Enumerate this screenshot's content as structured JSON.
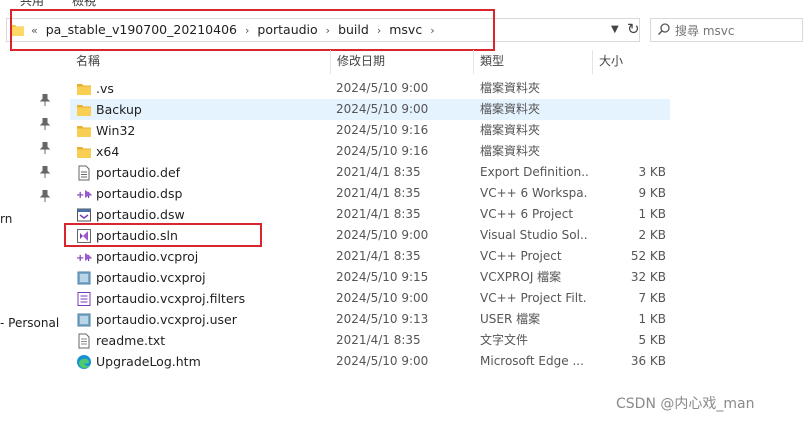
{
  "address_bar": {
    "overflow": "«",
    "crumbs": [
      "pa_stable_v190700_20210406",
      "portaudio",
      "build",
      "msvc"
    ]
  },
  "search": {
    "placeholder": "搜尋 msvc"
  },
  "nav": {
    "items": [
      {
        "label": "rn"
      },
      {
        "label": "- Personal"
      }
    ]
  },
  "columns": {
    "name": "名稱",
    "date": "修改日期",
    "type": "類型",
    "size": "大小"
  },
  "files": [
    {
      "icon": "folder-icon",
      "name": ".vs",
      "date": "2024/5/10 9:00",
      "type": "檔案資料夾",
      "size": ""
    },
    {
      "icon": "folder-icon",
      "name": "Backup",
      "date": "2024/5/10 9:00",
      "type": "檔案資料夾",
      "size": ""
    },
    {
      "icon": "folder-icon",
      "name": "Win32",
      "date": "2024/5/10 9:16",
      "type": "檔案資料夾",
      "size": ""
    },
    {
      "icon": "folder-icon",
      "name": "x64",
      "date": "2024/5/10 9:16",
      "type": "檔案資料夾",
      "size": ""
    },
    {
      "icon": "def-file-icon",
      "name": "portaudio.def",
      "date": "2021/4/1 8:35",
      "type": "Export Definition...",
      "size": "3 KB"
    },
    {
      "icon": "vcpp-project-icon",
      "name": "portaudio.dsp",
      "date": "2021/4/1 8:35",
      "type": "VC++ 6 Workspa...",
      "size": "9 KB"
    },
    {
      "icon": "dsw-file-icon",
      "name": "portaudio.dsw",
      "date": "2021/4/1 8:35",
      "type": "VC++ 6 Project",
      "size": "1 KB"
    },
    {
      "icon": "visual-studio-solution-icon",
      "name": "portaudio.sln",
      "date": "2024/5/10 9:00",
      "type": "Visual Studio Sol...",
      "size": "2 KB"
    },
    {
      "icon": "vcpp-project-icon",
      "name": "portaudio.vcproj",
      "date": "2021/4/1 8:35",
      "type": "VC++ Project",
      "size": "52 KB"
    },
    {
      "icon": "vcxproj-file-icon",
      "name": "portaudio.vcxproj",
      "date": "2024/5/10 9:15",
      "type": "VCXPROJ 檔案",
      "size": "32 KB"
    },
    {
      "icon": "filters-file-icon",
      "name": "portaudio.vcxproj.filters",
      "date": "2024/5/10 9:00",
      "type": "VC++ Project Filt...",
      "size": "7 KB"
    },
    {
      "icon": "vcxproj-file-icon",
      "name": "portaudio.vcxproj.user",
      "date": "2024/5/10 9:13",
      "type": "USER 檔案",
      "size": "1 KB"
    },
    {
      "icon": "text-file-icon",
      "name": "readme.txt",
      "date": "2021/4/1 8:35",
      "type": "文字文件",
      "size": "5 KB"
    },
    {
      "icon": "edge-browser-icon",
      "name": "UpgradeLog.htm",
      "date": "2024/5/10 9:00",
      "type": "Microsoft Edge ...",
      "size": "36 KB"
    }
  ],
  "selected_index": 1,
  "watermark": "CSDN @内心戏_man",
  "colors": {
    "highlight": "#d9262e",
    "selection": "#e5f3ff",
    "folder": "#f4c542"
  }
}
